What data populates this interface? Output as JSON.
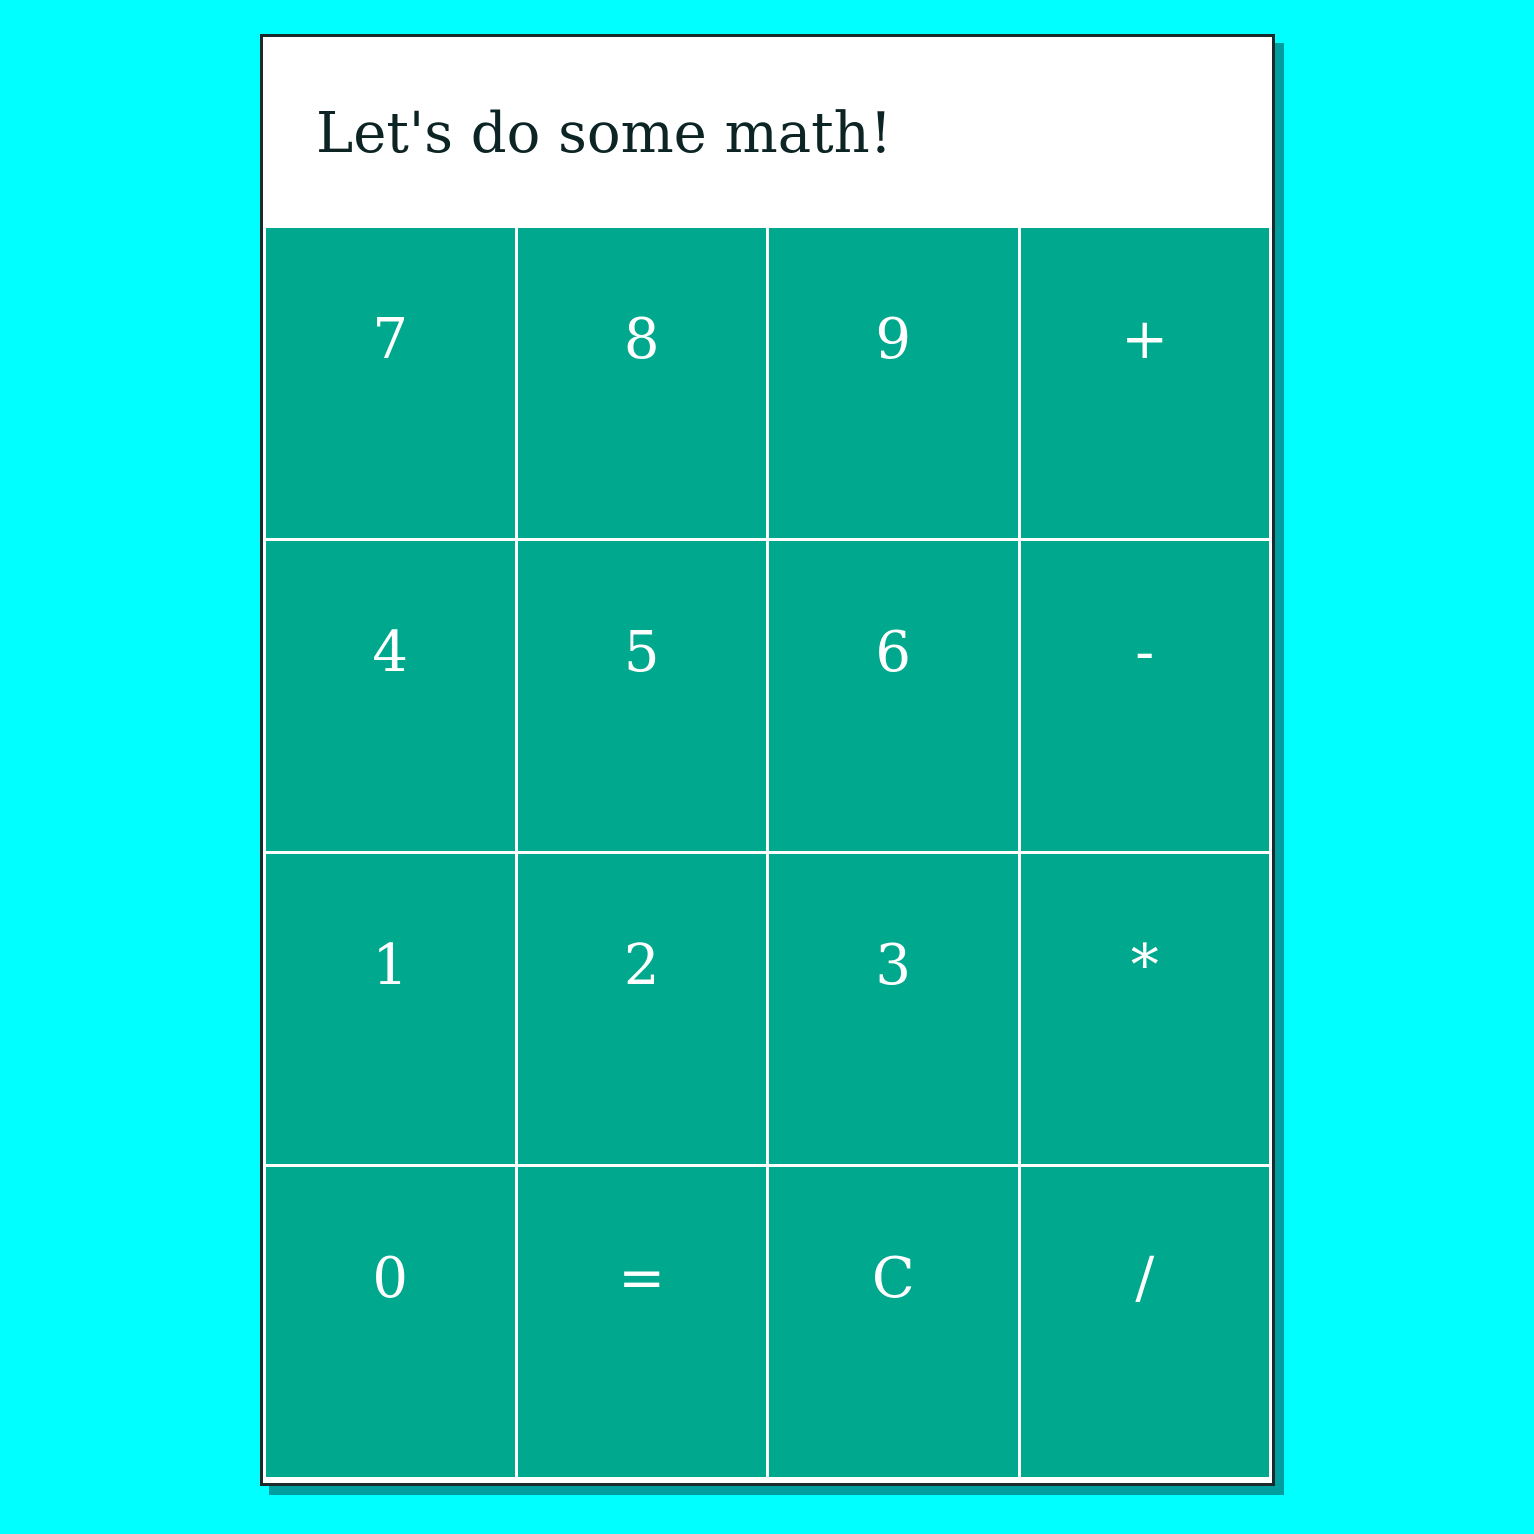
{
  "display": {
    "text": "Let's do some math!"
  },
  "keys": [
    {
      "label": "7"
    },
    {
      "label": "8"
    },
    {
      "label": "9"
    },
    {
      "label": "+"
    },
    {
      "label": "4"
    },
    {
      "label": "5"
    },
    {
      "label": "6"
    },
    {
      "label": "-"
    },
    {
      "label": "1"
    },
    {
      "label": "2"
    },
    {
      "label": "3"
    },
    {
      "label": "*"
    },
    {
      "label": "0"
    },
    {
      "label": "="
    },
    {
      "label": "C"
    },
    {
      "label": "/"
    }
  ],
  "colors": {
    "page_background": "#00ffff",
    "key_background": "#00a88d",
    "key_text": "#ffffff",
    "display_background": "#ffffff",
    "display_text": "#0d2424"
  }
}
